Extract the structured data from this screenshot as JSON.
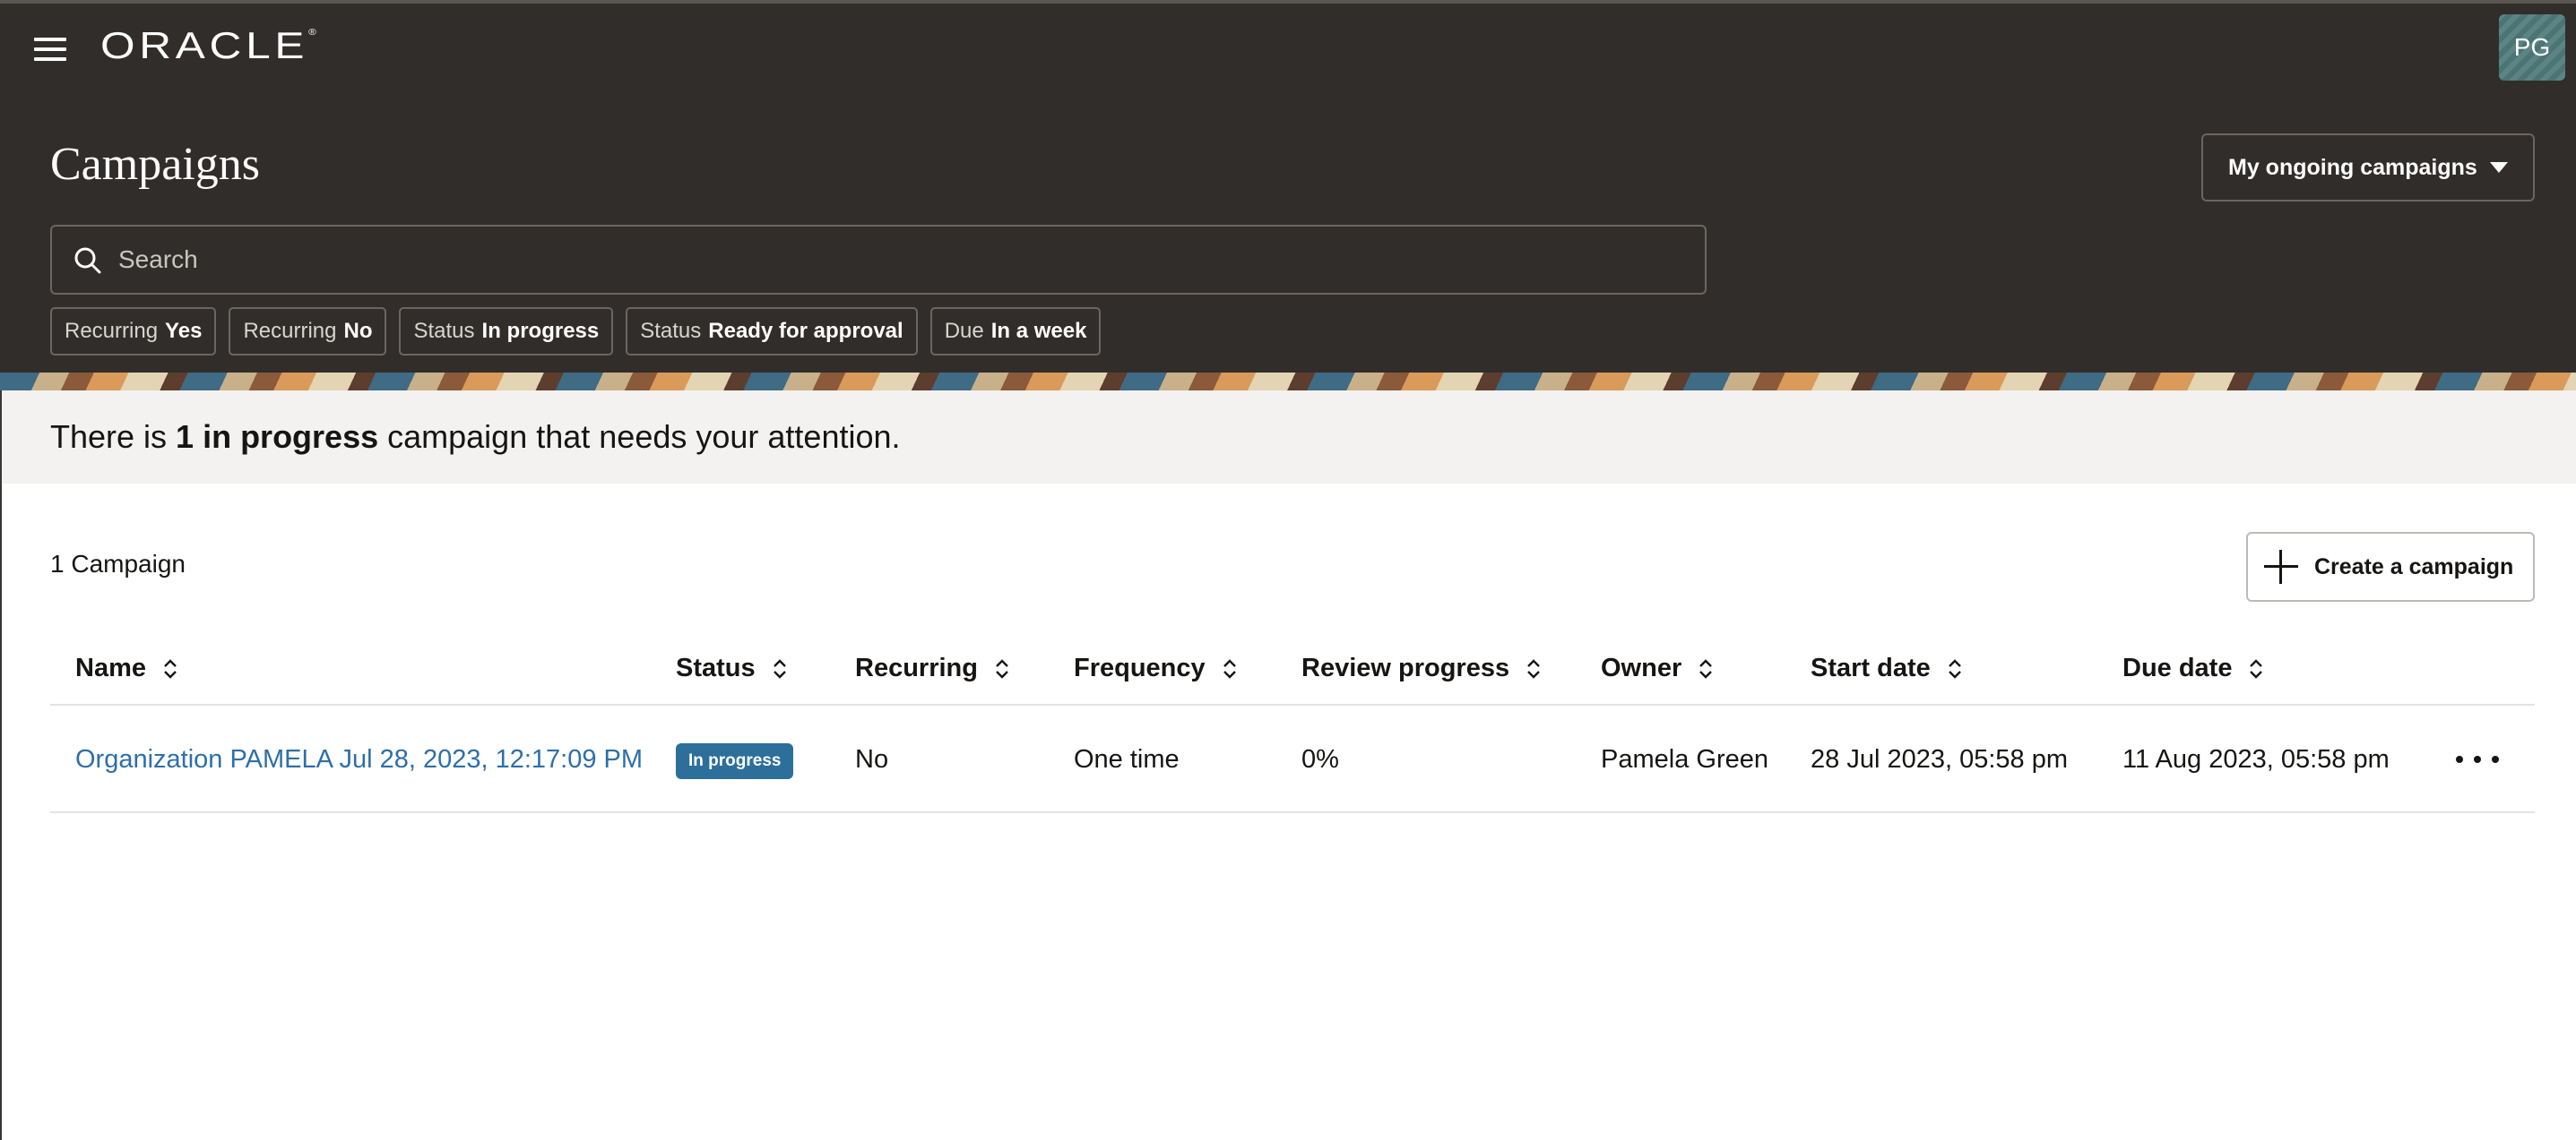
{
  "header": {
    "brand": "ORACLE",
    "avatar_initials": "PG",
    "page_title": "Campaigns",
    "filter_dropdown": "My ongoing campaigns",
    "search_placeholder": "Search"
  },
  "chips": [
    {
      "key": "Recurring",
      "value": "Yes"
    },
    {
      "key": "Recurring",
      "value": "No"
    },
    {
      "key": "Status",
      "value": "In progress"
    },
    {
      "key": "Status",
      "value": "Ready for approval"
    },
    {
      "key": "Due",
      "value": "In a week"
    }
  ],
  "notice": {
    "prefix": "There is",
    "highlight": "1 in progress",
    "suffix": "campaign that needs your attention."
  },
  "main": {
    "count": "1 Campaign",
    "create_button": "Create a campaign"
  },
  "table": {
    "columns": [
      "Name",
      "Status",
      "Recurring",
      "Frequency",
      "Review progress",
      "Owner",
      "Start date",
      "Due date"
    ],
    "rows": [
      {
        "name": "Organization PAMELA Jul 28, 2023, 12:17:09 PM",
        "status": "In progress",
        "recurring": "No",
        "frequency": "One time",
        "review_progress": "0%",
        "owner": "Pamela Green",
        "start_date": "28 Jul 2023, 05:58 pm",
        "due_date": "11 Aug 2023, 05:58 pm"
      }
    ]
  },
  "colors": {
    "header_bg": "#312d2a",
    "link": "#2d6fa8",
    "status_badge": "#2c6f9a",
    "notice_bg": "#f3f2f0"
  }
}
